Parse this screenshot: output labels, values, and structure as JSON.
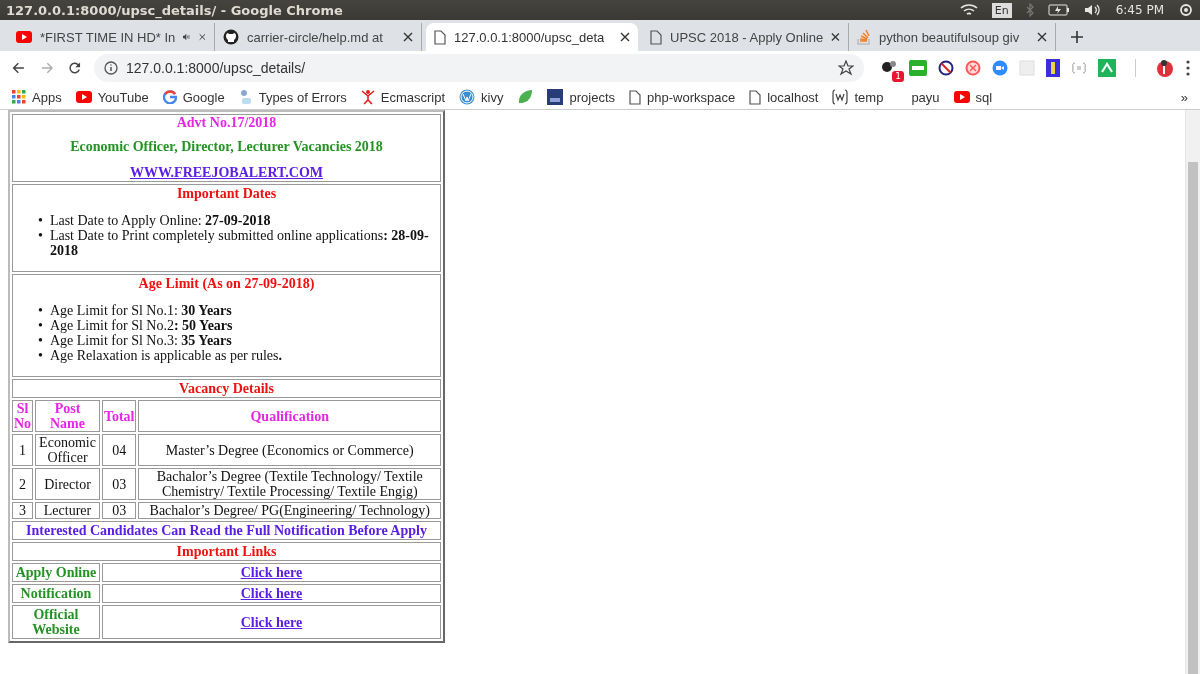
{
  "os_bar": {
    "title": "127.0.0.1:8000/upsc_details/ - Google Chrome",
    "keyboard": "En",
    "time": "6:45 PM"
  },
  "tabs": [
    {
      "title": "*FIRST TIME IN HD* In",
      "kind": "youtube",
      "audio": true,
      "selected": false
    },
    {
      "title": "carrier-circle/help.md at",
      "kind": "github",
      "audio": false,
      "selected": false
    },
    {
      "title": "127.0.0.1:8000/upsc_deta",
      "kind": "page",
      "audio": false,
      "selected": true
    },
    {
      "title": "UPSC 2018 - Apply Online",
      "kind": "page",
      "audio": false,
      "selected": false
    },
    {
      "title": "python beautifulsoup giv",
      "kind": "stack",
      "audio": false,
      "selected": false
    }
  ],
  "address_bar": {
    "url": "127.0.0.1:8000/upsc_details/",
    "extension_badge": "1"
  },
  "bookmarks": [
    {
      "label": "Apps",
      "kind": "apps"
    },
    {
      "label": "YouTube",
      "kind": "youtube"
    },
    {
      "label": "Google",
      "kind": "google"
    },
    {
      "label": "Types of Errors",
      "kind": "figure"
    },
    {
      "label": "Ecmascript",
      "kind": "person"
    },
    {
      "label": "kivy",
      "kind": "wordpress"
    },
    {
      "kind": "leaf"
    },
    {
      "label": "projects",
      "kind": "image"
    },
    {
      "label": "php-workspace",
      "kind": "page"
    },
    {
      "label": "localhost",
      "kind": "page"
    },
    {
      "label": "temp",
      "kind": "wiki"
    },
    {
      "label": "payu",
      "kind": "none"
    },
    {
      "label": "sql",
      "kind": "youtube"
    }
  ],
  "bookmarks_more": "»",
  "page": {
    "bullet": "•",
    "advt": "Advt No.17/2018",
    "headline": "Economic Officer, Director, Lecturer Vacancies 2018",
    "site_link": "WWW.FREEJOBALERT.COM",
    "dates_title": "Important Dates",
    "dates": [
      "Last Date to Apply Online: **27-09-2018**",
      "Last Date to Print completely submitted online applications**: 28-09-2018**"
    ],
    "age_title": "Age Limit (As on 27-09-2018)",
    "age": [
      "Age Limit for Sl No.1: **30 Years**",
      "Age Limit for Sl No.2**: 50 Years**",
      "Age Limit for Sl No.3: **35 Years**",
      "Age Relaxation is applicable as per rules**.**"
    ],
    "vacancy_title": "Vacancy Details",
    "columns": [
      "Sl No",
      "Post Name",
      "Total",
      "Qualification"
    ],
    "rows": [
      [
        "1",
        "Economic Officer",
        "04",
        "Master’s Degree (Economics or Commerce)"
      ],
      [
        "2",
        "Director",
        "03",
        "Bachalor’s Degree (Textile Technology/ Textile Chemistry/ Textile Processing/ Textile Engig)"
      ],
      [
        "3",
        "Lecturer",
        "03",
        "Bachalor’s Degree/ PG(Engineering/ Technology)"
      ]
    ],
    "notice": "Interested Candidates Can Read the Full Notification Before Apply",
    "links_title": "Important Links",
    "links": [
      {
        "label": "Apply Online",
        "link": "Click here"
      },
      {
        "label": "Notification",
        "link": "Click here"
      },
      {
        "label": "Official Website",
        "link": "Click here"
      }
    ]
  }
}
